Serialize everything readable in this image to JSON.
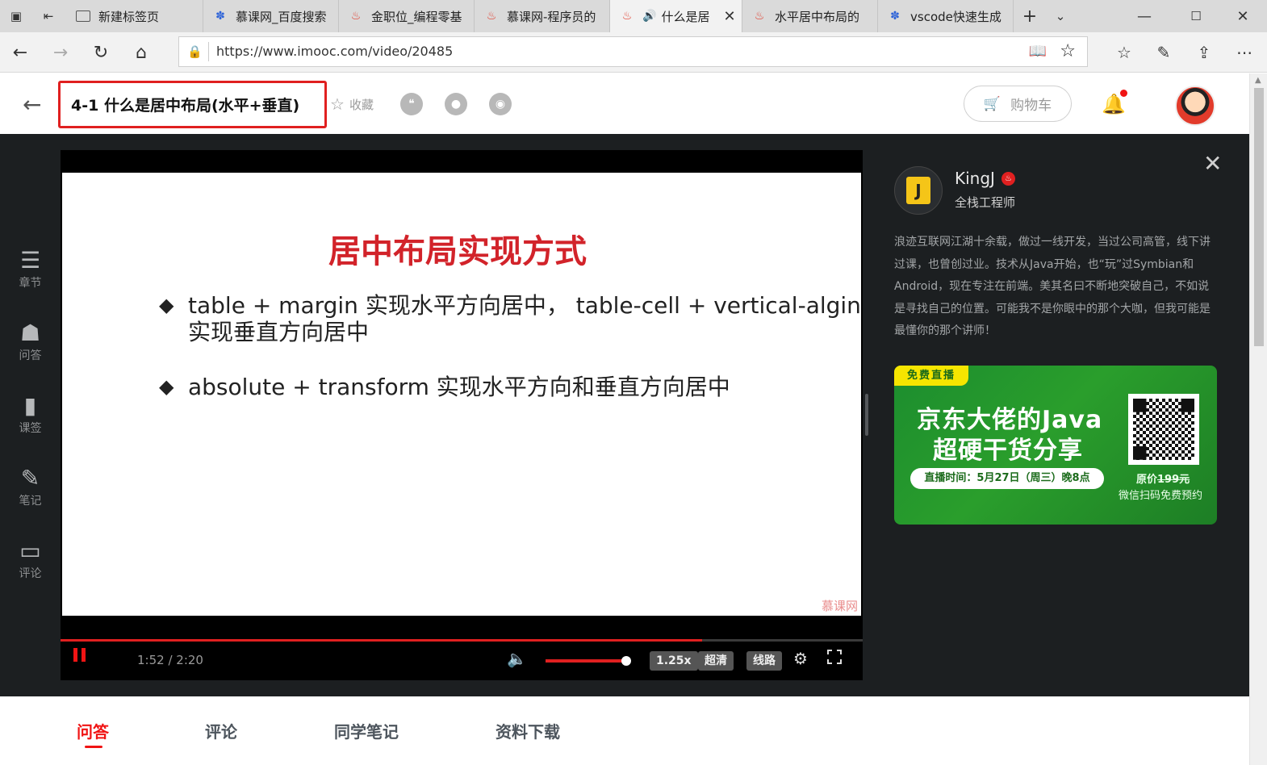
{
  "browser": {
    "tabs": [
      {
        "label": "新建标签页",
        "favicon": "page-icon"
      },
      {
        "label": "慕课网_百度搜索",
        "favicon": "baidu-paw-icon"
      },
      {
        "label": "金职位_编程零基",
        "favicon": "imooc-fire-icon"
      },
      {
        "label": "慕课网-程序员的",
        "favicon": "imooc-fire-icon"
      },
      {
        "label": "什么是居",
        "favicon": "imooc-fire-icon",
        "active": true
      },
      {
        "label": "水平居中布局的",
        "favicon": "imooc-fire-icon"
      },
      {
        "label": "vscode快速生成",
        "favicon": "baidu-paw-icon"
      }
    ],
    "url": "https://www.imooc.com/video/20485"
  },
  "header": {
    "title": "4-1 什么是居中布局(水平+垂直)",
    "collect_label": "收藏",
    "cart_label": "购物车",
    "notification_dot_color": "#f01414"
  },
  "leftnav": [
    {
      "label": "章节",
      "icon": "chapters-icon"
    },
    {
      "label": "问答",
      "icon": "qa-icon"
    },
    {
      "label": "课签",
      "icon": "bookmark-icon"
    },
    {
      "label": "笔记",
      "icon": "note-pen-icon"
    },
    {
      "label": "评论",
      "icon": "comment-icon"
    }
  ],
  "video": {
    "slide_title": "居中布局实现方式",
    "bullets": [
      {
        "line1": "table + margin 实现水平方向居中， table-cell + vertical-algin",
        "line2": "实现垂直方向居中"
      },
      {
        "line1": "absolute + transform 实现水平方向和垂直方向居中",
        "line2": ""
      }
    ],
    "watermark": "慕课网",
    "time": "1:52 / 2:20",
    "progress": 0.8,
    "volume": 1.0,
    "speed": "1.25x",
    "quality": "超清",
    "line": "线路",
    "accent_color": "#e02020"
  },
  "teacher": {
    "name": "KingJ",
    "title": "全栈工程师",
    "bio": "浪迹互联网江湖十余载，做过一线开发，当过公司高管，线下讲过课，也曾创过业。技术从Java开始，也“玩”过Symbian和Android，现在专注在前端。美其名曰不断地突破自己，不如说是寻找自己的位置。可能我不是你眼中的那个大咖，但我可能是最懂你的那个讲师！"
  },
  "ad": {
    "tag": "免费直播",
    "line1": "京东大佬的Java",
    "line2": "超硬干货分享",
    "live_time": "直播时间：5月27日（周三）晚8点",
    "original_price_label": "原价",
    "original_price": "199元",
    "scan_text": "微信扫码免费预约"
  },
  "bottom_tabs": [
    {
      "label": "问答",
      "active": true
    },
    {
      "label": "评论"
    },
    {
      "label": "同学笔记"
    },
    {
      "label": "资料下载"
    }
  ]
}
